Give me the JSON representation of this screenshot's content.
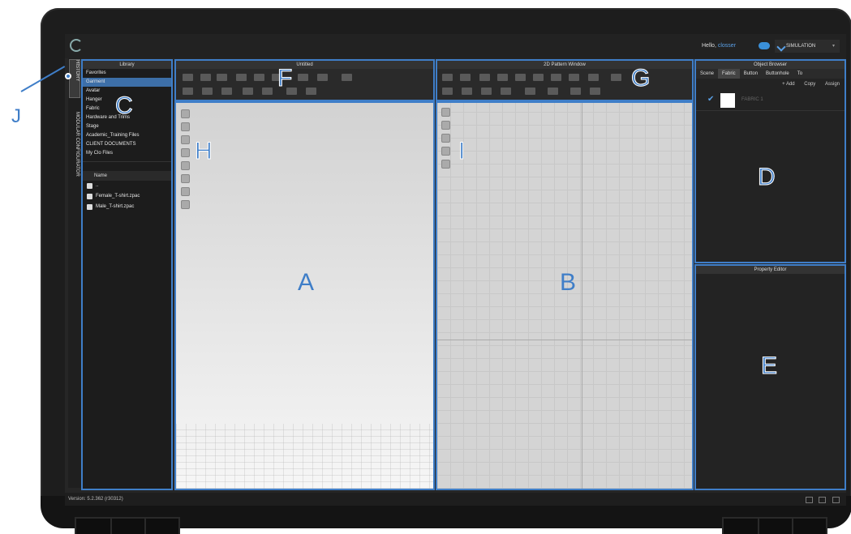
{
  "app": {
    "greeting": "Hello,",
    "user": "closser",
    "mode": "SIMULATION",
    "version": "Version: 5.2.362 (r30312)"
  },
  "side_tabs": [
    "HISTORY",
    "MODULAR CONFIGURATOR"
  ],
  "library": {
    "title": "Library",
    "items": [
      "Favorites",
      "Garment",
      "Avatar",
      "Hanger",
      "Fabric",
      "Hardware and Trims",
      "Stage",
      "Academic_Training Files",
      "CLIENT DOCUMENTS",
      "My Clo Files"
    ],
    "selected": "Garment",
    "column_header": "Name",
    "files": [
      "..",
      "Female_T-shirt.zpac",
      "Male_T-shirt.zpac"
    ]
  },
  "viewport_3d": {
    "title": "Untitled"
  },
  "viewport_2d": {
    "title": "2D Pattern Window"
  },
  "object_browser": {
    "title": "Object Browser",
    "tabs": [
      "Scene",
      "Fabric",
      "Button",
      "Buttonhole",
      "To"
    ],
    "active_tab": "Fabric",
    "buttons": [
      "+ Add",
      "Copy",
      "Assign"
    ],
    "fabric_name": "FABRIC 1"
  },
  "property_editor": {
    "title": "Property Editor"
  },
  "labels": {
    "A": "A",
    "B": "B",
    "C": "C",
    "D": "D",
    "E": "E",
    "F": "F",
    "G": "G",
    "H": "H",
    "I": "I",
    "J": "J"
  },
  "colors": {
    "accent": "#3f7ec8",
    "selection": "#3d6fa8",
    "bezel": "#1d1d1d"
  }
}
